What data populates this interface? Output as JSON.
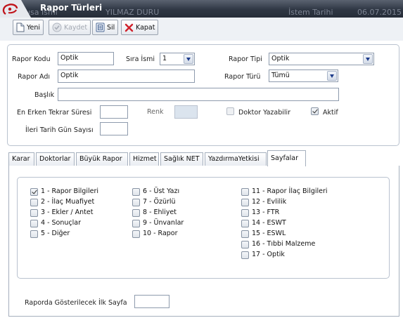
{
  "window": {
    "title": "Rapor Türleri",
    "ghost_texts": [
      "ısa İsmi",
      "YILMAZ DURU",
      "İstem Tarihi",
      "06.07.2015"
    ]
  },
  "toolbar": {
    "new_label": "Yeni",
    "save_label": "Kaydet",
    "delete_label": "Sil",
    "close_label": "Kapat"
  },
  "form": {
    "rapor_kodu": {
      "label": "Rapor Kodu",
      "value": "Optik"
    },
    "sira_ismi": {
      "label": "Sıra İsmi",
      "value": "1"
    },
    "rapor_tipi": {
      "label": "Rapor Tipi",
      "value": "Optik"
    },
    "rapor_adi": {
      "label": "Rapor Adı",
      "value": "Optik"
    },
    "rapor_turu": {
      "label": "Rapor Türü",
      "value": "Tümü"
    },
    "baslik": {
      "label": "Başlık",
      "value": ""
    },
    "en_erken": {
      "label": "En Erken Tekrar Süresi",
      "value": ""
    },
    "renk": {
      "label": "Renk"
    },
    "doktor_yazabilir": {
      "label": "Doktor Yazabilir",
      "checked": false
    },
    "aktif": {
      "label": "Aktif",
      "checked": true
    },
    "ileri_tarih": {
      "label": "İleri Tarih Gün Sayısı",
      "value": ""
    }
  },
  "tabs": [
    "Karar",
    "Doktorlar",
    "Büyük Rapor",
    "Hizmet",
    "Sağlık NET",
    "YazdırmaYetkisi",
    "Sayfalar"
  ],
  "active_tab": "Sayfalar",
  "pages": {
    "col1": [
      {
        "label": "1 - Rapor Bilgileri",
        "checked": true
      },
      {
        "label": "2 - İlaç Muafiyet",
        "checked": false
      },
      {
        "label": "3 - Ekler / Antet",
        "checked": false
      },
      {
        "label": "4 - Sonuçlar",
        "checked": false
      },
      {
        "label": "5 - Diğer",
        "checked": false
      }
    ],
    "col2": [
      {
        "label": "6 - Üst Yazı",
        "checked": false
      },
      {
        "label": "7 - Özürlü",
        "checked": false
      },
      {
        "label": "8 - Ehliyet",
        "checked": false
      },
      {
        "label": "9 - Ünvanlar",
        "checked": false
      },
      {
        "label": "10 - Rapor",
        "checked": false
      }
    ],
    "col3": [
      {
        "label": "11 - Rapor İlaç Bilgileri",
        "checked": false
      },
      {
        "label": "12 - Evlilik",
        "checked": false
      },
      {
        "label": "13 - FTR",
        "checked": false
      },
      {
        "label": "14 - ESWT",
        "checked": false
      },
      {
        "label": "15 - ESWL",
        "checked": false
      },
      {
        "label": "16 - Tıbbi Malzeme",
        "checked": false
      },
      {
        "label": "17 - Optik",
        "checked": false
      }
    ]
  },
  "first_page": {
    "label": "Raporda Gösterilecek İlk Sayfa",
    "value": ""
  }
}
